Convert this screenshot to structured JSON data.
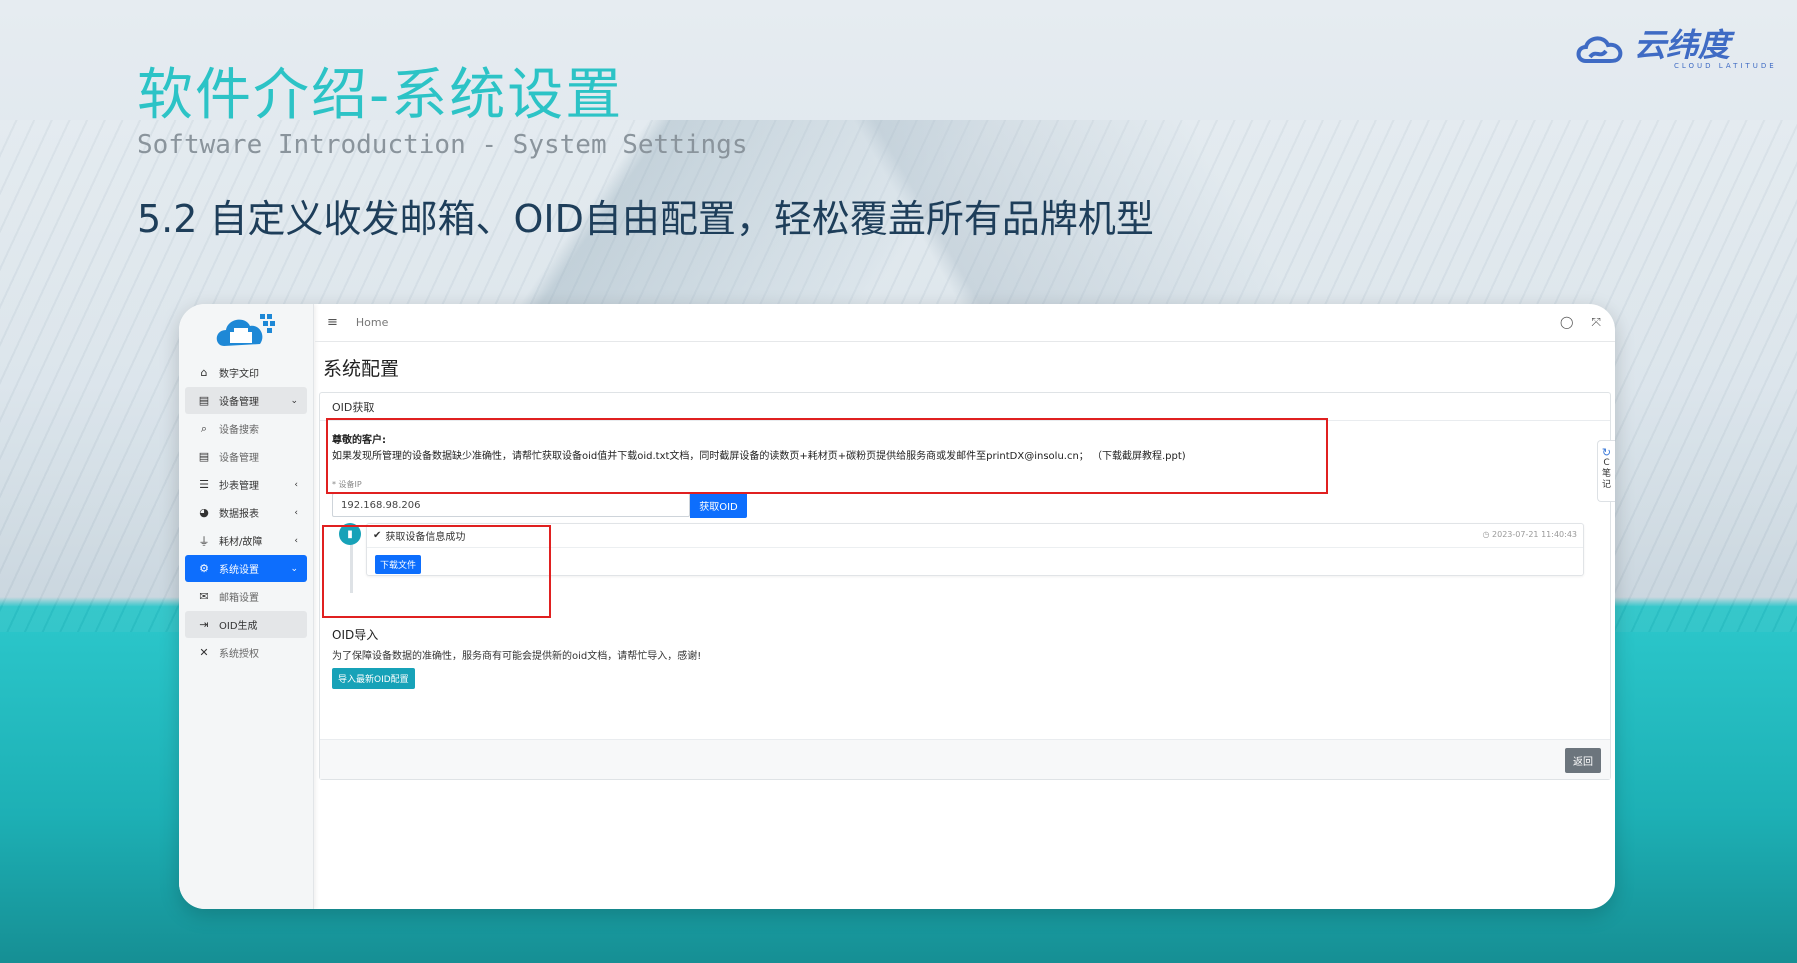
{
  "slide": {
    "title_cn": "软件介绍-系统设置",
    "title_en": "Software Introduction - System Settings",
    "subtitle": "5.2  自定义收发邮箱、OID自由配置，轻松覆盖所有品牌机型",
    "logo_cn": "云纬度",
    "logo_en": "CLOUD LATITUDE"
  },
  "sidebar": {
    "items": [
      {
        "label": "数字文印",
        "icon": "home-icon"
      },
      {
        "label": "设备管理",
        "icon": "printer-icon"
      },
      {
        "label": "设备搜索",
        "icon": "search-icon"
      },
      {
        "label": "设备管理",
        "icon": "printer-icon"
      },
      {
        "label": "抄表管理",
        "icon": "list-icon"
      },
      {
        "label": "数据报表",
        "icon": "pie-chart-icon"
      },
      {
        "label": "耗材/故障",
        "icon": "plug-icon"
      },
      {
        "label": "系统设置",
        "icon": "gears-icon"
      },
      {
        "label": "邮箱设置",
        "icon": "envelope-icon"
      },
      {
        "label": "OID生成",
        "icon": "file-export-icon"
      },
      {
        "label": "系统授权",
        "icon": "tools-icon"
      }
    ]
  },
  "topbar": {
    "breadcrumb": "Home"
  },
  "page": {
    "title": "系统配置",
    "card_header": "OID获取",
    "notice_title": "尊敬的客户:",
    "notice_body": "如果发现所管理的设备数据缺少准确性，请帮忙获取设备oid值并下载oid.txt文档，同时截屏设备的读数页+耗材页+碳粉页提供给服务商或发邮件至printDX@insolu.cn；  （下载截屏教程.ppt)",
    "field_label": "* 设备IP",
    "ip_value": "192.168.98.206",
    "get_oid_button": "获取OID",
    "timeline_status": "获取设备信息成功",
    "timeline_time": "2023-07-21 11:40:43",
    "download_button": "下载文件",
    "import_title": "OID导入",
    "import_text": "为了保障设备数据的准确性，服务商有可能会提供新的oid文档，请帮忙导入，感谢!",
    "import_button": "导入最新OID配置",
    "back_button": "返回"
  },
  "side_tab": {
    "label_top": "C",
    "label_1": "笔",
    "label_2": "记"
  },
  "colors": {
    "accent_teal": "#2cc3c6",
    "primary_blue": "#0d6efd",
    "highlight_red": "#e02020",
    "info": "#17a2b8"
  }
}
